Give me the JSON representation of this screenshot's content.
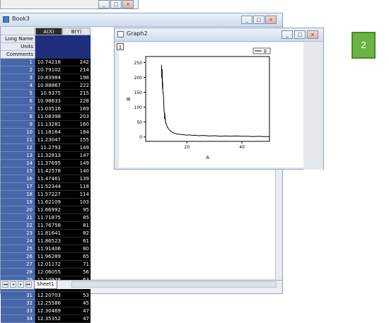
{
  "book": {
    "title": "Book3",
    "columns": [
      "A(X)",
      "B(Y)"
    ],
    "meta_labels": [
      "Long Name",
      "Units",
      "Comments"
    ],
    "rows": [
      [
        "1",
        "10.74218",
        "242"
      ],
      [
        "2",
        "10.79102",
        "214"
      ],
      [
        "3",
        "10.83984",
        "198"
      ],
      [
        "4",
        "10.88867",
        "222"
      ],
      [
        "5",
        "10.9375",
        "215"
      ],
      [
        "6",
        "10.98633",
        "228"
      ],
      [
        "7",
        "11.03516",
        "169"
      ],
      [
        "8",
        "11.08398",
        "203"
      ],
      [
        "9",
        "11.13281",
        "160"
      ],
      [
        "10",
        "11.18164",
        "184"
      ],
      [
        "11",
        "11.23047",
        "155"
      ],
      [
        "12",
        "11.2793",
        "149"
      ],
      [
        "13",
        "11.32813",
        "147"
      ],
      [
        "14",
        "11.37695",
        "149"
      ],
      [
        "15",
        "11.42578",
        "140"
      ],
      [
        "16",
        "11.47461",
        "139"
      ],
      [
        "17",
        "11.52344",
        "118"
      ],
      [
        "18",
        "11.57227",
        "114"
      ],
      [
        "19",
        "11.62109",
        "103"
      ],
      [
        "20",
        "11.66992",
        "95"
      ],
      [
        "21",
        "11.71875",
        "85"
      ],
      [
        "22",
        "11.76758",
        "81"
      ],
      [
        "23",
        "11.81641",
        "82"
      ],
      [
        "24",
        "11.86523",
        "61"
      ],
      [
        "25",
        "11.91406",
        "80"
      ],
      [
        "26",
        "11.96289",
        "65"
      ],
      [
        "27",
        "12.01172",
        "71"
      ],
      [
        "28",
        "12.06055",
        "56"
      ],
      [
        "29",
        "12.10938",
        "63"
      ],
      [
        "30",
        "12.1582",
        "59"
      ],
      [
        "31",
        "12.20703",
        "53"
      ],
      [
        "32",
        "12.25586",
        "45"
      ],
      [
        "33",
        "12.30469",
        "47"
      ],
      [
        "34",
        "12.35352",
        "47"
      ]
    ],
    "sheet_tab": "Sheet1",
    "nav": [
      "◂",
      "▸",
      "◂◂",
      "▸▸"
    ]
  },
  "graph": {
    "title": "Graph2",
    "layer": "1",
    "window_controls": [
      "_",
      "□",
      "×"
    ]
  },
  "chart_data": {
    "type": "line",
    "xlabel": "A",
    "ylabel": "B",
    "xlim": [
      5,
      50
    ],
    "ylim": [
      -15,
      270
    ],
    "xticks": [
      20,
      40
    ],
    "yticks": [
      0,
      50,
      100,
      150,
      200,
      250
    ],
    "grid": false,
    "legend": "top-right",
    "series": [
      {
        "name": "B",
        "x": [
          10.74,
          10.79,
          10.84,
          10.89,
          10.94,
          10.99,
          11.04,
          11.08,
          11.13,
          11.18,
          11.23,
          11.28,
          11.33,
          11.38,
          11.43,
          11.47,
          11.52,
          11.57,
          11.62,
          11.67,
          11.72,
          11.77,
          11.82,
          11.87,
          11.91,
          11.96,
          12.01,
          12.06,
          12.11,
          12.16,
          12.21,
          12.26,
          12.3,
          12.35,
          12.6,
          12.9,
          13.2,
          13.6,
          14.0,
          14.5,
          15.0,
          15.5,
          16.0,
          17.0,
          18.0,
          19.0,
          20.0,
          21.0,
          22.0,
          23.0,
          24.0,
          26.0,
          28.0,
          30.0,
          32.0,
          34.0,
          36.0,
          38.0,
          40.0,
          42.0,
          44.0,
          46.0,
          48.0,
          50.0
        ],
        "y": [
          242,
          214,
          198,
          222,
          215,
          228,
          169,
          203,
          160,
          184,
          155,
          149,
          147,
          149,
          140,
          139,
          118,
          114,
          103,
          95,
          85,
          81,
          82,
          61,
          80,
          65,
          71,
          56,
          63,
          59,
          53,
          45,
          47,
          47,
          40,
          34,
          28,
          24,
          20,
          17,
          14,
          12,
          11,
          9,
          8,
          7,
          6,
          7,
          5,
          6,
          4,
          5,
          3,
          4,
          2,
          3,
          2,
          3,
          2,
          2,
          1,
          2,
          1,
          1
        ]
      }
    ]
  },
  "badge": {
    "label": "2",
    "color": "#6bb342"
  }
}
